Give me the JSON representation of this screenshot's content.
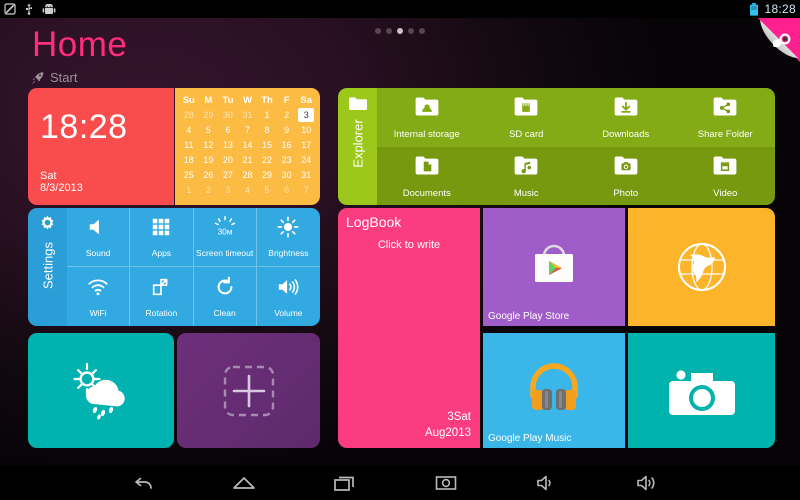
{
  "statusbar": {
    "time": "18:28",
    "left_icons": [
      "sim-card-icon",
      "usb-icon",
      "android-robot-icon"
    ],
    "right_icons": [
      "battery-icon"
    ]
  },
  "header": {
    "title": "Home",
    "start_label": "Start",
    "start_icon": "rocket-icon",
    "page_dots": {
      "count": 5,
      "active_index": 2
    }
  },
  "page_curl": {
    "icon": "hand-magnifier-icon",
    "color": "#ff1f8e"
  },
  "clock_widget": {
    "time": "18:28",
    "day": "Sat",
    "date": "8/3/2013",
    "color": "#f94c4c"
  },
  "calendar_widget": {
    "color": "#fcbb42",
    "headers": [
      "Su",
      "M",
      "Tu",
      "W",
      "Th",
      "F",
      "Sa"
    ],
    "weeks": [
      [
        {
          "d": "28",
          "m": "prev"
        },
        {
          "d": "29",
          "m": "prev"
        },
        {
          "d": "30",
          "m": "prev"
        },
        {
          "d": "31",
          "m": "prev"
        },
        {
          "d": "1",
          "m": "cur"
        },
        {
          "d": "2",
          "m": "cur"
        },
        {
          "d": "3",
          "m": "today"
        }
      ],
      [
        {
          "d": "4",
          "m": "cur"
        },
        {
          "d": "5",
          "m": "cur"
        },
        {
          "d": "6",
          "m": "cur"
        },
        {
          "d": "7",
          "m": "cur"
        },
        {
          "d": "8",
          "m": "cur"
        },
        {
          "d": "9",
          "m": "cur"
        },
        {
          "d": "10",
          "m": "cur"
        }
      ],
      [
        {
          "d": "11",
          "m": "cur"
        },
        {
          "d": "12",
          "m": "cur"
        },
        {
          "d": "13",
          "m": "cur"
        },
        {
          "d": "14",
          "m": "cur"
        },
        {
          "d": "15",
          "m": "cur"
        },
        {
          "d": "16",
          "m": "cur"
        },
        {
          "d": "17",
          "m": "cur"
        }
      ],
      [
        {
          "d": "18",
          "m": "cur"
        },
        {
          "d": "19",
          "m": "cur"
        },
        {
          "d": "20",
          "m": "cur"
        },
        {
          "d": "21",
          "m": "cur"
        },
        {
          "d": "22",
          "m": "cur"
        },
        {
          "d": "23",
          "m": "cur"
        },
        {
          "d": "24",
          "m": "cur"
        }
      ],
      [
        {
          "d": "25",
          "m": "cur"
        },
        {
          "d": "26",
          "m": "cur"
        },
        {
          "d": "27",
          "m": "cur"
        },
        {
          "d": "28",
          "m": "cur"
        },
        {
          "d": "29",
          "m": "cur"
        },
        {
          "d": "30",
          "m": "cur"
        },
        {
          "d": "31",
          "m": "cur"
        }
      ],
      [
        {
          "d": "1",
          "m": "next"
        },
        {
          "d": "2",
          "m": "next"
        },
        {
          "d": "3",
          "m": "next"
        },
        {
          "d": "4",
          "m": "next"
        },
        {
          "d": "5",
          "m": "next"
        },
        {
          "d": "6",
          "m": "next"
        },
        {
          "d": "7",
          "m": "next"
        }
      ]
    ]
  },
  "explorer": {
    "side_label": "Explorer",
    "side_icon": "folder-icon",
    "side_color": "#9cc81b",
    "items": [
      {
        "label": "Internal storage",
        "icon": "folder-internal-storage-icon"
      },
      {
        "label": "SD card",
        "icon": "folder-sdcard-icon"
      },
      {
        "label": "Downloads",
        "icon": "folder-download-icon"
      },
      {
        "label": "Share Folder",
        "icon": "folder-share-icon"
      },
      {
        "label": "Documents",
        "icon": "folder-document-icon"
      },
      {
        "label": "Music",
        "icon": "folder-music-icon"
      },
      {
        "label": "Photo",
        "icon": "folder-photo-icon"
      },
      {
        "label": "Video",
        "icon": "folder-video-icon"
      }
    ]
  },
  "settings": {
    "side_label": "Settings",
    "side_icon": "gear-icon",
    "side_color": "#2b9ed8",
    "items": [
      {
        "label": "Sound",
        "icon": "speaker-icon"
      },
      {
        "label": "Apps",
        "icon": "apps-grid-icon"
      },
      {
        "label": "Screen timeout",
        "icon": "screen-timeout-30m-icon"
      },
      {
        "label": "Brightness",
        "icon": "sun-icon"
      },
      {
        "label": "WiFi",
        "icon": "wifi-icon"
      },
      {
        "label": "Rotation",
        "icon": "rotation-icon"
      },
      {
        "label": "Clean",
        "icon": "refresh-icon"
      },
      {
        "label": "Volume",
        "icon": "volume-icon"
      }
    ]
  },
  "logbook": {
    "title": "LogBook",
    "hint": "Click to write",
    "day": "3Sat",
    "month": "Aug2013",
    "color": "#fb3d7f"
  },
  "apps": {
    "play_store": {
      "label": "Google Play Store",
      "icon": "google-play-store-icon",
      "color": "#a05cc8"
    },
    "browser": {
      "label": "",
      "icon": "globe-icon",
      "color": "#fcb52b"
    },
    "weather": {
      "label": "",
      "icon": "sun-rain-cloud-icon",
      "color": "#00b3b0"
    },
    "add_widget": {
      "label": "",
      "icon": "add-widget-plus-icon",
      "color": "#6d2f7a"
    },
    "play_music": {
      "label": "Google Play Music",
      "icon": "google-play-music-icon",
      "color": "#3bb6e8"
    },
    "camera": {
      "label": "",
      "icon": "camera-icon",
      "color": "#00b3ad"
    }
  },
  "navbar": {
    "buttons": [
      {
        "name": "back",
        "icon": "back-arrow-icon"
      },
      {
        "name": "home",
        "icon": "home-icon"
      },
      {
        "name": "recents",
        "icon": "recent-apps-icon"
      },
      {
        "name": "screenshot",
        "icon": "screenshot-camera-icon"
      },
      {
        "name": "volume-down",
        "icon": "volume-down-icon"
      },
      {
        "name": "volume-up",
        "icon": "volume-up-icon"
      }
    ]
  }
}
